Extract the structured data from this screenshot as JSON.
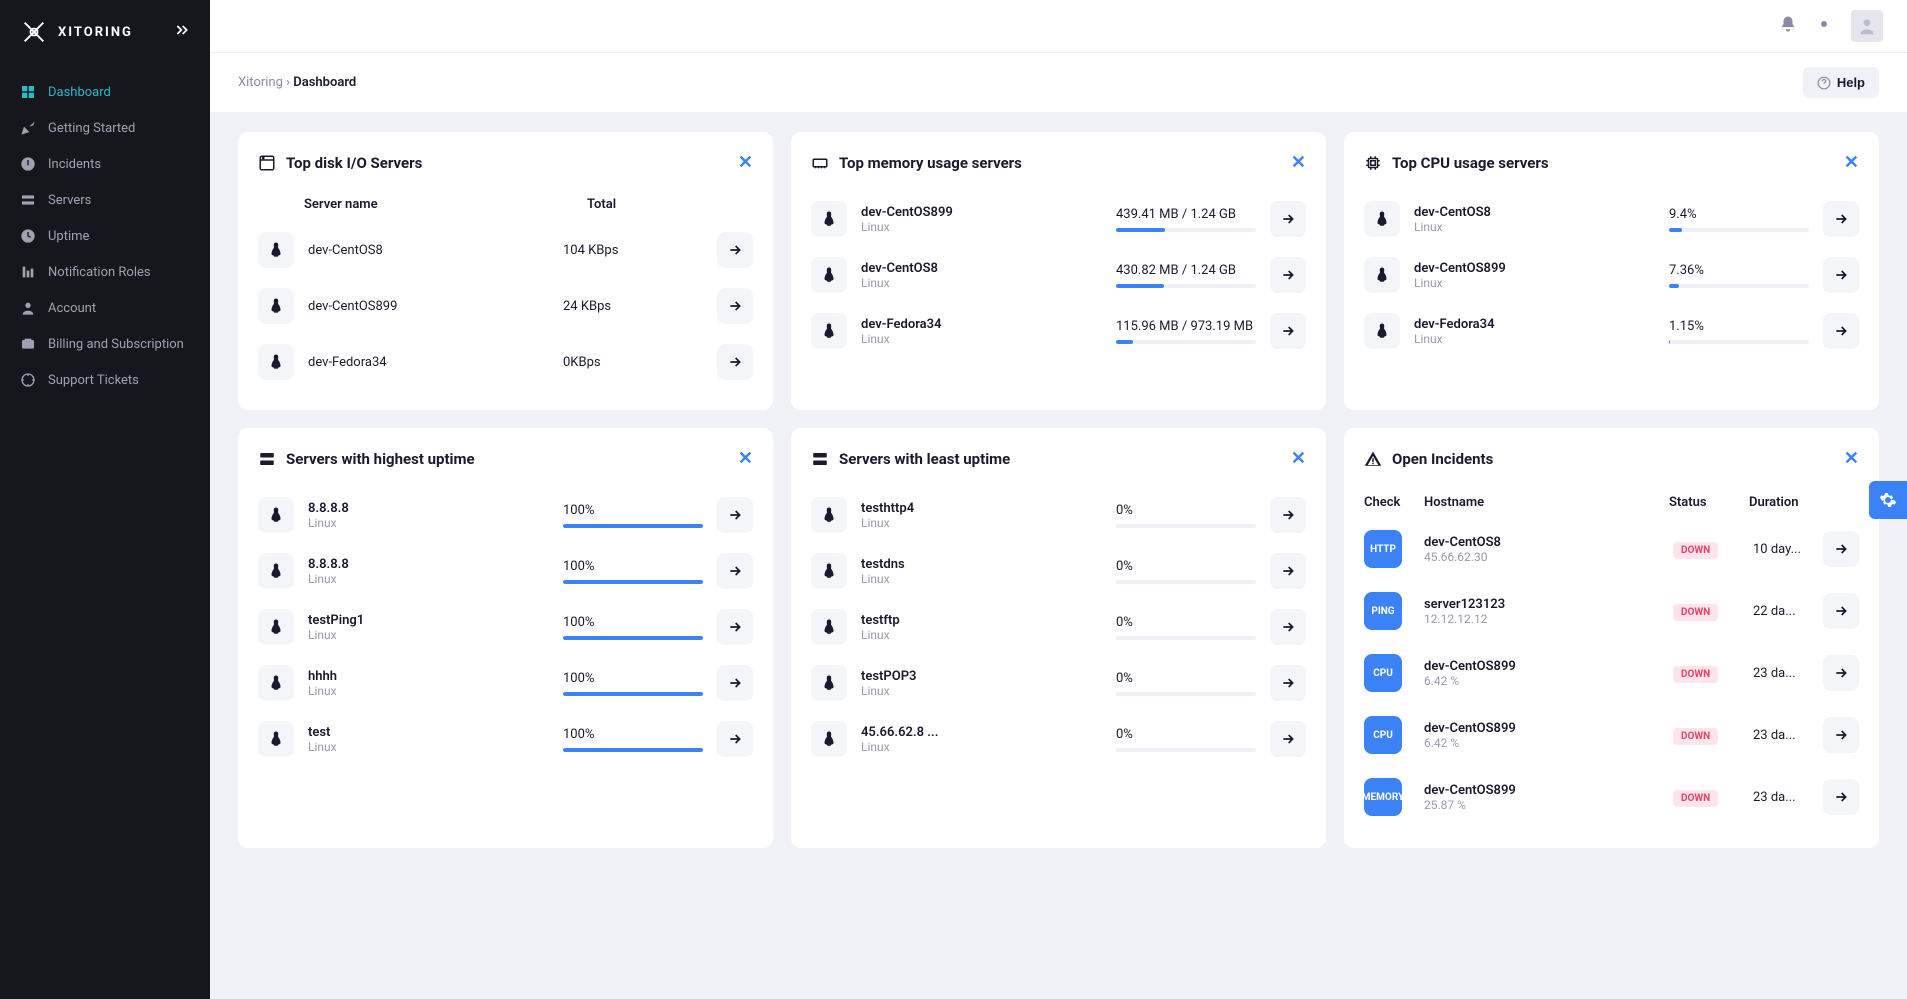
{
  "brand": "XITORING",
  "breadcrumb": {
    "root": "Xitoring",
    "sep": "›",
    "current": "Dashboard"
  },
  "help_label": "Help",
  "sidebar": {
    "items": [
      {
        "label": "Dashboard",
        "active": true
      },
      {
        "label": "Getting Started",
        "active": false
      },
      {
        "label": "Incidents",
        "active": false
      },
      {
        "label": "Servers",
        "active": false
      },
      {
        "label": "Uptime",
        "active": false
      },
      {
        "label": "Notification Roles",
        "active": false
      },
      {
        "label": "Account",
        "active": false
      },
      {
        "label": "Billing and Subscription",
        "active": false
      },
      {
        "label": "Support Tickets",
        "active": false
      }
    ]
  },
  "cards": {
    "disk": {
      "title": "Top disk I/O Servers",
      "headers": {
        "name": "Server name",
        "total": "Total"
      },
      "rows": [
        {
          "name": "dev-CentOS8",
          "total": "104 KBps"
        },
        {
          "name": "dev-CentOS899",
          "total": "24 KBps"
        },
        {
          "name": "dev-Fedora34",
          "total": "0KBps"
        }
      ]
    },
    "memory": {
      "title": "Top memory usage servers",
      "rows": [
        {
          "name": "dev-CentOS899",
          "os": "Linux",
          "text": "439.41 MB / 1.24 GB",
          "pct": 35
        },
        {
          "name": "dev-CentOS8",
          "os": "Linux",
          "text": "430.82 MB / 1.24 GB",
          "pct": 34
        },
        {
          "name": "dev-Fedora34",
          "os": "Linux",
          "text": "115.96 MB / 973.19 MB",
          "pct": 12
        }
      ]
    },
    "cpu": {
      "title": "Top CPU usage servers",
      "rows": [
        {
          "name": "dev-CentOS8",
          "os": "Linux",
          "text": "9.4%",
          "pct": 9
        },
        {
          "name": "dev-CentOS899",
          "os": "Linux",
          "text": "7.36%",
          "pct": 7
        },
        {
          "name": "dev-Fedora34",
          "os": "Linux",
          "text": "1.15%",
          "pct": 1
        }
      ]
    },
    "highup": {
      "title": "Servers with highest uptime",
      "rows": [
        {
          "name": "8.8.8.8",
          "os": "Linux",
          "text": "100%",
          "pct": 100
        },
        {
          "name": "8.8.8.8",
          "os": "Linux",
          "text": "100%",
          "pct": 100
        },
        {
          "name": "testPing1",
          "os": "Linux",
          "text": "100%",
          "pct": 100
        },
        {
          "name": "hhhh",
          "os": "Linux",
          "text": "100%",
          "pct": 100
        },
        {
          "name": "test",
          "os": "Linux",
          "text": "100%",
          "pct": 100
        }
      ]
    },
    "lowup": {
      "title": "Servers with least uptime",
      "rows": [
        {
          "name": "testhttp4",
          "os": "Linux",
          "text": "0%",
          "pct": 0
        },
        {
          "name": "testdns",
          "os": "Linux",
          "text": "0%",
          "pct": 0
        },
        {
          "name": "testftp",
          "os": "Linux",
          "text": "0%",
          "pct": 0
        },
        {
          "name": "testPOP3",
          "os": "Linux",
          "text": "0%",
          "pct": 0
        },
        {
          "name": "45.66.62.8 ...",
          "os": "Linux",
          "text": "0%",
          "pct": 0
        }
      ]
    },
    "incidents": {
      "title": "Open Incidents",
      "headers": {
        "check": "Check",
        "host": "Hostname",
        "status": "Status",
        "dur": "Duration"
      },
      "rows": [
        {
          "check": "HTTP",
          "host": "dev-CentOS8",
          "sub": "45.66.62.30",
          "status": "DOWN",
          "dur": "10 day..."
        },
        {
          "check": "PING",
          "host": "server123123",
          "sub": "12.12.12.12",
          "status": "DOWN",
          "dur": "22 da..."
        },
        {
          "check": "CPU",
          "host": "dev-CentOS899",
          "sub": "6.42 %",
          "status": "DOWN",
          "dur": "23 da..."
        },
        {
          "check": "CPU",
          "host": "dev-CentOS899",
          "sub": "6.42 %",
          "status": "DOWN",
          "dur": "23 da..."
        },
        {
          "check": "MEMORY",
          "host": "dev-CentOS899",
          "sub": "25.87 %",
          "status": "DOWN",
          "dur": "23 da..."
        }
      ]
    }
  }
}
